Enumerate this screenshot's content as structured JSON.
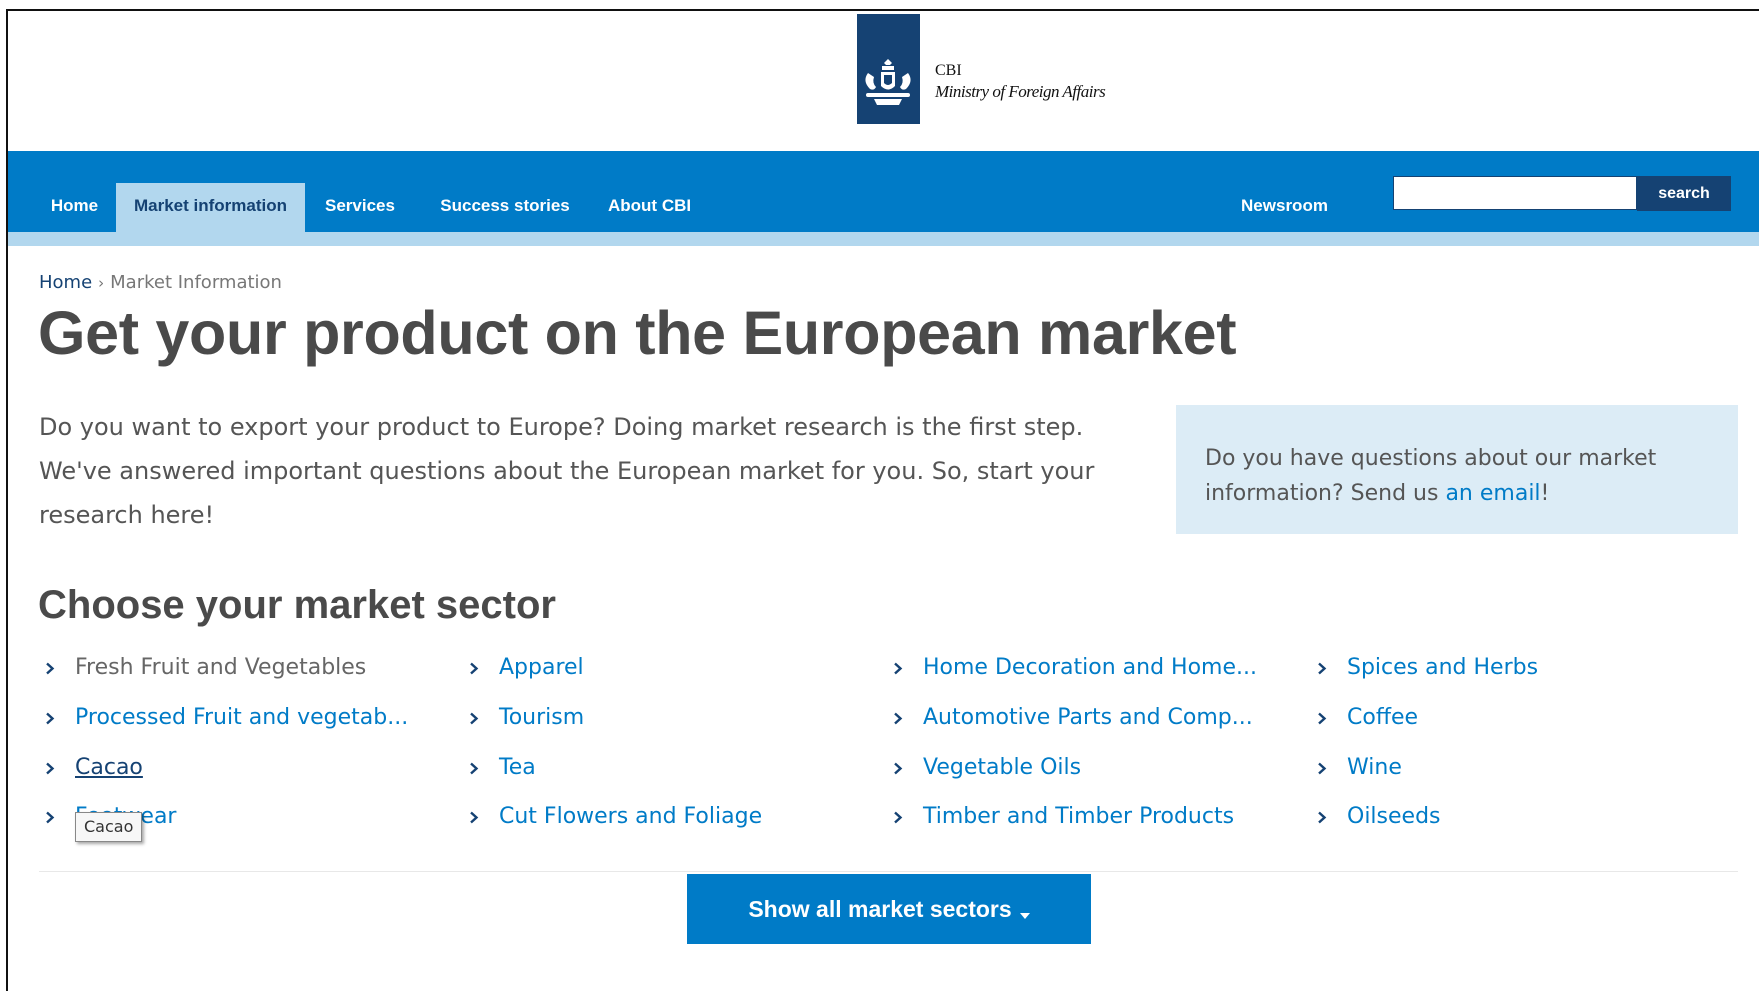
{
  "header": {
    "org_short": "CBI",
    "org_full": "Ministry of Foreign Affairs",
    "brand_color": "#154273"
  },
  "nav": {
    "items": [
      {
        "label": "Home",
        "active": false
      },
      {
        "label": "Market information",
        "active": true
      },
      {
        "label": "Services",
        "active": false
      },
      {
        "label": "Success stories",
        "active": false
      },
      {
        "label": "About CBI",
        "active": false
      }
    ],
    "newsroom": "Newsroom",
    "search": {
      "value": "",
      "placeholder": "",
      "button": "search"
    },
    "bar_color": "#007bc7",
    "active_color": "#b2d7ee"
  },
  "breadcrumb": {
    "home": "Home",
    "separator": "›",
    "current": "Market Information"
  },
  "page_title": "Get your product on the European market",
  "intro": "Do you want to export your product to Europe? Doing market research is the first step. We've answered important questions about the European market for you. So, start your research here!",
  "info_box": {
    "text_before": "Do you have questions about our market information? Send us ",
    "link": "an email",
    "text_after": "!"
  },
  "sectors": {
    "heading": "Choose your market sector",
    "columns": [
      [
        "Fresh Fruit and Vegetables",
        "Processed Fruit and vegetab...",
        "Cacao",
        "Footwear"
      ],
      [
        "Apparel",
        "Tourism",
        "Tea",
        "Cut Flowers and Foliage"
      ],
      [
        "Home Decoration and Home...",
        "Automotive Parts and Comp...",
        "Vegetable Oils",
        "Timber and Timber Products"
      ],
      [
        "Spices and Herbs",
        "Coffee",
        "Wine",
        "Oilseeds"
      ]
    ],
    "hovered": "Cacao",
    "tooltip": "Cacao",
    "show_all": "Show all market sectors",
    "link_color": "#007bc7"
  }
}
